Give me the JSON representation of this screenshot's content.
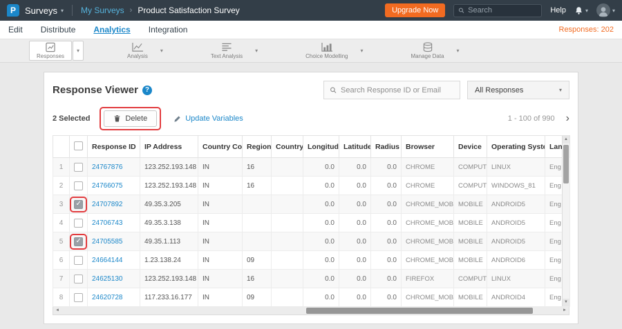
{
  "colors": {
    "topbar_bg": "#333e48",
    "accent_blue": "#1b87c9",
    "accent_orange": "#f26b21",
    "annotation_red": "#e23b3e"
  },
  "icons": {
    "caret_down": "▾",
    "chevron_sep": "›",
    "pagination_next": "›",
    "sort_up": "▲",
    "sort_down": "▼",
    "scroll_up": "▲",
    "scroll_down": "▼",
    "scroll_left": "◄",
    "scroll_right": "►",
    "help_question": "?",
    "logo_letter": "P"
  },
  "topbar": {
    "brand": "Surveys",
    "breadcrumb": "My Surveys",
    "title": "Product Satisfaction Survey",
    "upgrade_label": "Upgrade Now",
    "search_placeholder": "Search",
    "help_label": "Help"
  },
  "nav": {
    "tabs": [
      "Edit",
      "Distribute",
      "Analytics",
      "Integration"
    ],
    "responses_count": "Responses: 202"
  },
  "toolbar": {
    "items": [
      "Responses",
      "Analysis",
      "Text Analysis",
      "Choice Modelling",
      "Manage Data"
    ]
  },
  "viewer": {
    "title": "Response Viewer",
    "search_placeholder": "Search Response ID or Email",
    "filter_value": "All Responses",
    "selected_text": "2 Selected",
    "delete_label": "Delete",
    "update_variables_label": "Update Variables",
    "pagination": "1 - 100 of 990"
  },
  "table": {
    "headers": [
      "Response ID",
      "IP Address",
      "Country Code",
      "Region",
      "Country",
      "Longitude",
      "Latitude",
      "Radius",
      "Browser",
      "Device",
      "Operating System",
      "Lan"
    ],
    "rows": [
      {
        "num": "1",
        "checked": false,
        "annotated": false,
        "cells": [
          "24767876",
          "123.252.193.148",
          "IN",
          "16",
          "",
          "0.0",
          "0.0",
          "0.0",
          "CHROME",
          "COMPUTER",
          "LINUX",
          "Eng"
        ]
      },
      {
        "num": "2",
        "checked": false,
        "annotated": false,
        "cells": [
          "24766075",
          "123.252.193.148",
          "IN",
          "16",
          "",
          "0.0",
          "0.0",
          "0.0",
          "CHROME",
          "COMPUTER",
          "WINDOWS_81",
          "Eng"
        ]
      },
      {
        "num": "3",
        "checked": true,
        "annotated": true,
        "cells": [
          "24707892",
          "49.35.3.205",
          "IN",
          "",
          "",
          "0.0",
          "0.0",
          "0.0",
          "CHROME_MOBILE",
          "MOBILE",
          "ANDROID5",
          "Eng"
        ]
      },
      {
        "num": "4",
        "checked": false,
        "annotated": false,
        "cells": [
          "24706743",
          "49.35.3.138",
          "IN",
          "",
          "",
          "0.0",
          "0.0",
          "0.0",
          "CHROME_MOBILE",
          "MOBILE",
          "ANDROID5",
          "Eng"
        ]
      },
      {
        "num": "5",
        "checked": true,
        "annotated": true,
        "cells": [
          "24705585",
          "49.35.1.113",
          "IN",
          "",
          "",
          "0.0",
          "0.0",
          "0.0",
          "CHROME_MOBILE",
          "MOBILE",
          "ANDROID5",
          "Eng"
        ]
      },
      {
        "num": "6",
        "checked": false,
        "annotated": false,
        "cells": [
          "24664144",
          "1.23.138.24",
          "IN",
          "09",
          "",
          "0.0",
          "0.0",
          "0.0",
          "CHROME_MOBILE",
          "MOBILE",
          "ANDROID6",
          "Eng"
        ]
      },
      {
        "num": "7",
        "checked": false,
        "annotated": false,
        "cells": [
          "24625130",
          "123.252.193.148",
          "IN",
          "16",
          "",
          "0.0",
          "0.0",
          "0.0",
          "FIREFOX",
          "COMPUTER",
          "LINUX",
          "Eng"
        ]
      },
      {
        "num": "8",
        "checked": false,
        "annotated": false,
        "cells": [
          "24620728",
          "117.233.16.177",
          "IN",
          "09",
          "",
          "0.0",
          "0.0",
          "0.0",
          "CHROME_MOBILE",
          "MOBILE",
          "ANDROID4",
          "Eng"
        ]
      }
    ]
  }
}
